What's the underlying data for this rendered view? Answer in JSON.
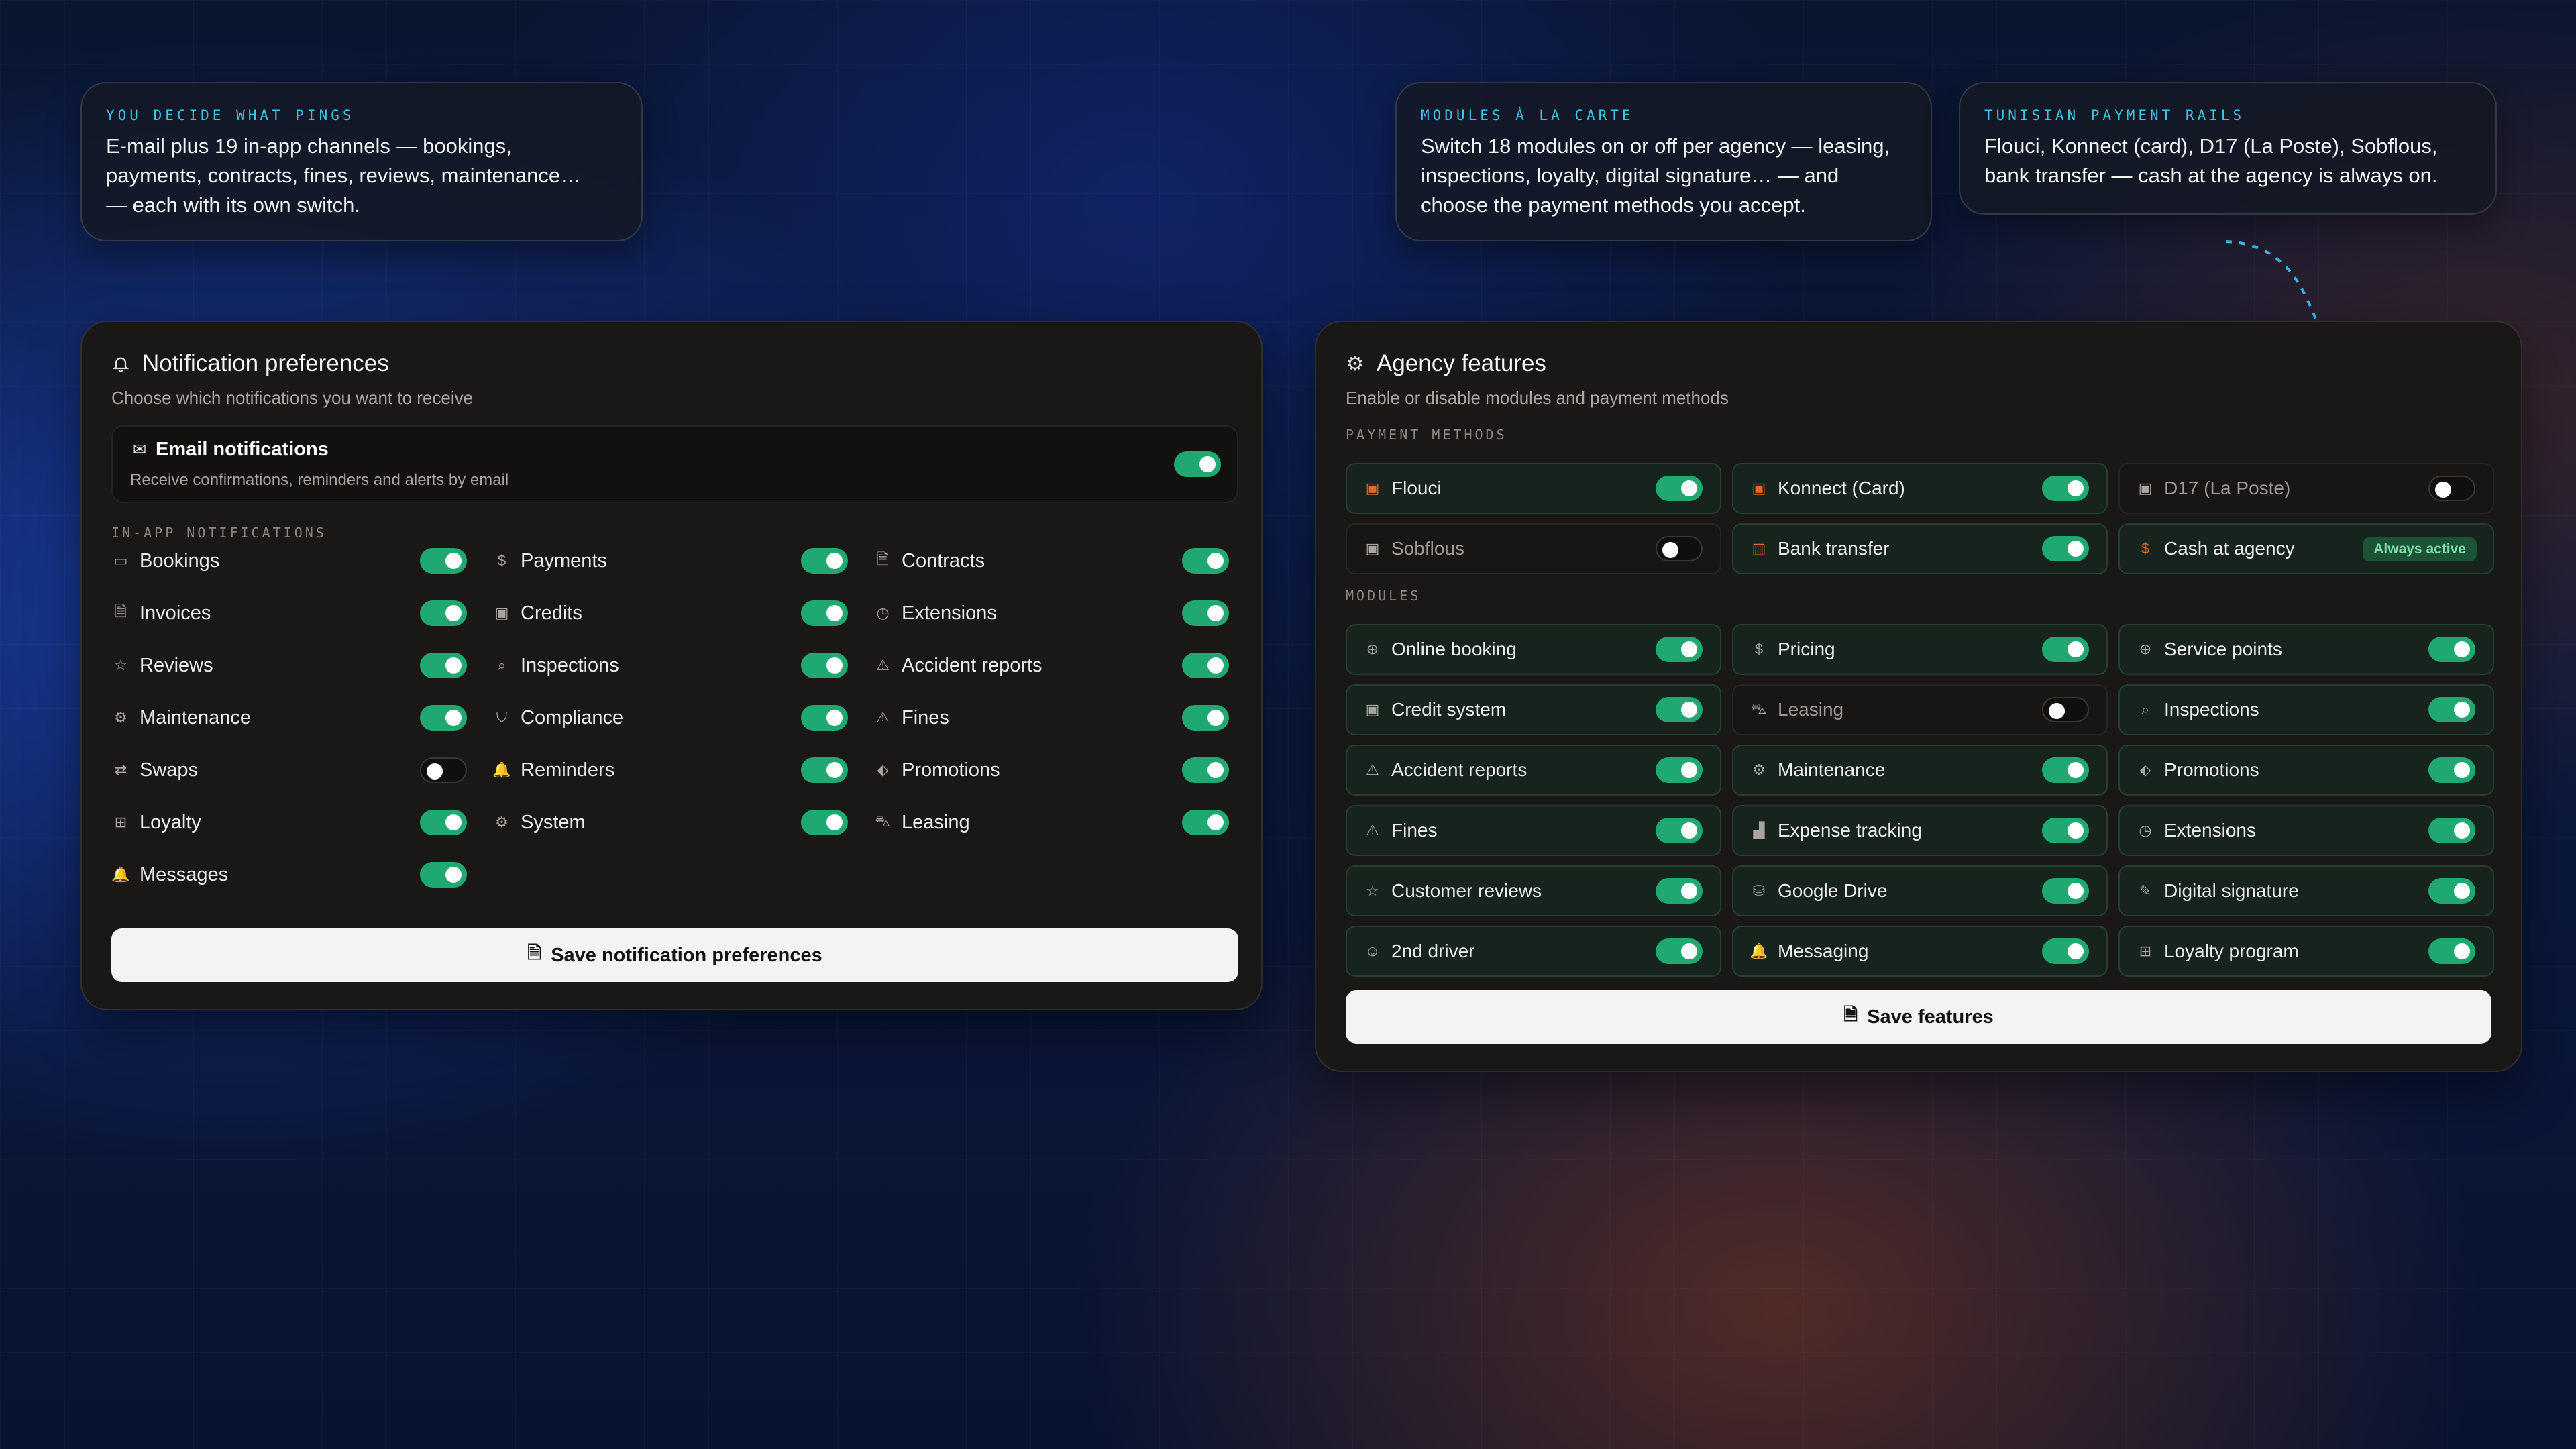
{
  "callouts": [
    {
      "kicker": "YOU DECIDE WHAT PINGS",
      "line1": "E-mail plus 19 in-app channels — bookings,",
      "line2": "payments, contracts, fines, reviews, maintenance…",
      "line3": "— each with its own switch."
    },
    {
      "kicker": "MODULES À LA CARTE",
      "line1": "Switch 18 modules on or off per agency — leasing,",
      "line2": "inspections, loyalty, digital signature… — and",
      "line3": "choose the payment methods you accept."
    },
    {
      "kicker": "TUNISIAN PAYMENT RAILS",
      "line1": "Flouci, Konnect (card), D17 (La Poste), Sobflous,",
      "line2": "bank transfer — cash at the agency is always on."
    }
  ],
  "notifications": {
    "title": "Notification preferences",
    "subtitle": "Choose which notifications you want to receive",
    "email": {
      "title": "Email notifications",
      "desc": "Receive confirmations, reminders and alerts by email",
      "on": true
    },
    "inapp_label": "IN-APP NOTIFICATIONS",
    "columns": [
      [
        {
          "label": "Bookings",
          "icon": "calendar-icon",
          "on": true
        },
        {
          "label": "Invoices",
          "icon": "invoice-icon",
          "on": true
        },
        {
          "label": "Reviews",
          "icon": "star-icon",
          "on": true
        },
        {
          "label": "Maintenance",
          "icon": "gear-icon",
          "on": true
        },
        {
          "label": "Swaps",
          "icon": "swap-icon",
          "on": false
        },
        {
          "label": "Loyalty",
          "icon": "gift-icon",
          "on": true
        },
        {
          "label": "Messages",
          "icon": "bell-icon",
          "on": true
        }
      ],
      [
        {
          "label": "Payments",
          "icon": "dollar-icon",
          "on": true
        },
        {
          "label": "Credits",
          "icon": "wallet-icon",
          "on": true
        },
        {
          "label": "Inspections",
          "icon": "search-icon",
          "on": true
        },
        {
          "label": "Compliance",
          "icon": "shield-icon",
          "on": true
        },
        {
          "label": "Reminders",
          "icon": "bell-icon",
          "on": true
        },
        {
          "label": "System",
          "icon": "gear-icon",
          "on": true
        }
      ],
      [
        {
          "label": "Contracts",
          "icon": "document-icon",
          "on": true
        },
        {
          "label": "Extensions",
          "icon": "clock-icon",
          "on": true
        },
        {
          "label": "Accident reports",
          "icon": "warning-icon",
          "on": true
        },
        {
          "label": "Fines",
          "icon": "warning-icon",
          "on": true
        },
        {
          "label": "Promotions",
          "icon": "tag-icon",
          "on": true
        },
        {
          "label": "Leasing",
          "icon": "car-icon",
          "on": true
        }
      ]
    ],
    "save_label": "Save notification preferences"
  },
  "features": {
    "title": "Agency features",
    "subtitle": "Enable or disable modules and payment methods",
    "payment_label": "PAYMENT METHODS",
    "payments": [
      {
        "label": "Flouci",
        "icon": "wallet-icon",
        "on": true
      },
      {
        "label": "Konnect (Card)",
        "icon": "wallet-icon",
        "on": true
      },
      {
        "label": "D17 (La Poste)",
        "icon": "wallet-icon",
        "on": false
      },
      {
        "label": "Sobflous",
        "icon": "wallet-icon",
        "on": false
      },
      {
        "label": "Bank transfer",
        "icon": "bank-icon",
        "on": true
      },
      {
        "label": "Cash at agency",
        "icon": "dollar-icon",
        "on": true,
        "badge": "Always active"
      }
    ],
    "modules_label": "MODULES",
    "modules": [
      {
        "label": "Online booking",
        "icon": "globe-icon",
        "on": true
      },
      {
        "label": "Pricing",
        "icon": "dollar-icon",
        "on": true
      },
      {
        "label": "Service points",
        "icon": "globe-icon",
        "on": true
      },
      {
        "label": "Credit system",
        "icon": "wallet-icon",
        "on": true
      },
      {
        "label": "Leasing",
        "icon": "car-icon",
        "on": false
      },
      {
        "label": "Inspections",
        "icon": "search-icon",
        "on": true
      },
      {
        "label": "Accident reports",
        "icon": "warning-icon",
        "on": true
      },
      {
        "label": "Maintenance",
        "icon": "gear-icon",
        "on": true
      },
      {
        "label": "Promotions",
        "icon": "tag-icon",
        "on": true
      },
      {
        "label": "Fines",
        "icon": "warning-icon",
        "on": true
      },
      {
        "label": "Expense tracking",
        "icon": "chart-icon",
        "on": true
      },
      {
        "label": "Extensions",
        "icon": "clock-icon",
        "on": true
      },
      {
        "label": "Customer reviews",
        "icon": "star-icon",
        "on": true
      },
      {
        "label": "Google Drive",
        "icon": "database-icon",
        "on": true
      },
      {
        "label": "Digital signature",
        "icon": "pen-icon",
        "on": true
      },
      {
        "label": "2nd driver",
        "icon": "user-icon",
        "on": true
      },
      {
        "label": "Messaging",
        "icon": "bell-icon",
        "on": true
      },
      {
        "label": "Loyalty program",
        "icon": "gift-icon",
        "on": true
      }
    ],
    "save_label": "Save features"
  },
  "colors": {
    "accent_green": "#1fa971",
    "callout_kicker": "#3ec6e6",
    "payment_icon": "#e0672d"
  }
}
